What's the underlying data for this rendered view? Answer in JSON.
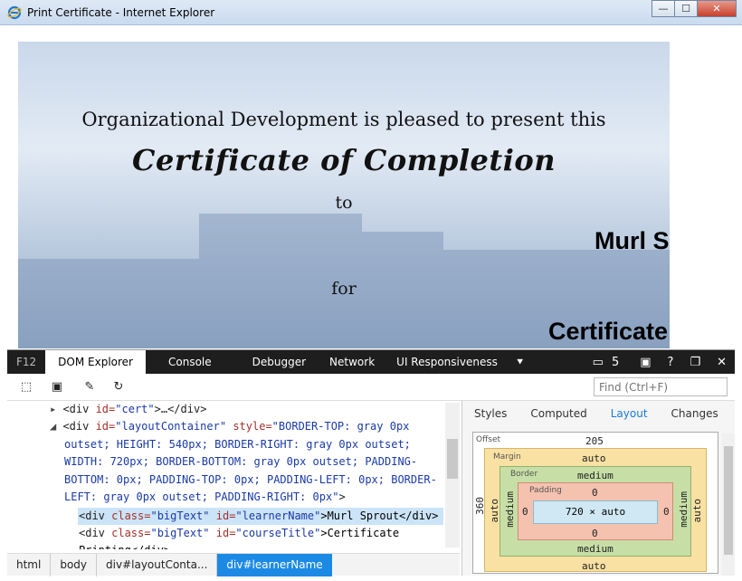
{
  "window": {
    "title": "Print Certificate - Internet Explorer",
    "minimize": "—",
    "maximize": "☐",
    "close": "✕"
  },
  "certificate": {
    "line1": "Organizational Development is pleased to present this",
    "line2": "Certificate of Completion",
    "line3": "to",
    "line4": "for",
    "learner": "Murl S",
    "course": "Certificate"
  },
  "devtools": {
    "tabs": [
      "F12",
      "DOM Explorer",
      "Console",
      "Debugger",
      "Network",
      "UI Responsiveness"
    ],
    "emulation_count": "5",
    "find_placeholder": "Find (Ctrl+F)",
    "dom": {
      "line1": {
        "tag_open": "<div ",
        "attr": "id=",
        "val": "\"cert\"",
        "rest": ">…</div>"
      },
      "line2a": {
        "tag_open": "<div ",
        "attr1": "id=",
        "val1": "\"layoutContainer\"",
        "attr2": " style=",
        "val2": "\"BORDER-TOP: gray 0px"
      },
      "line2b": "outset; HEIGHT: 540px; BORDER-RIGHT: gray 0px outset;",
      "line2c": "WIDTH: 720px; BORDER-BOTTOM: gray 0px outset; PADDING-",
      "line2d": "BOTTOM: 0px; PADDING-TOP: 0px; PADDING-LEFT: 0px; BORDER-",
      "line2e": "LEFT: gray 0px outset; PADDING-RIGHT: 0px\"",
      "line2e_close": ">",
      "line3": {
        "tag_open": "<div ",
        "attr1": "class=",
        "val1": "\"bigText\"",
        "attr2": " id=",
        "val2": "\"learnerName\"",
        "text": ">Murl Sprout</div>"
      },
      "line4": {
        "tag_open": "<div ",
        "attr1": "class=",
        "val1": "\"bigText\"",
        "attr2": " id=",
        "val2": "\"courseTitle\"",
        "text": ">Certificate"
      },
      "line5": "Printing</div>"
    },
    "breadcrumbs": [
      "html",
      "body",
      "div#layoutConta...",
      "div#learnerName"
    ],
    "side_tabs": [
      "Styles",
      "Computed",
      "Layout",
      "Changes"
    ],
    "layout": {
      "offset_label": "Offset",
      "offset_top": "205",
      "offset_left": "360",
      "margin_label": "Margin",
      "margin_top": "auto",
      "margin_bottom": "auto",
      "margin_left": "auto",
      "margin_right": "auto",
      "border_label": "Border",
      "border_top": "medium",
      "border_bottom": "medium",
      "border_left": "medium",
      "border_right": "medium",
      "padding_label": "Padding",
      "padding_top": "0",
      "padding_bottom": "0",
      "padding_left": "0",
      "padding_right": "0",
      "content": "720 × auto"
    }
  }
}
